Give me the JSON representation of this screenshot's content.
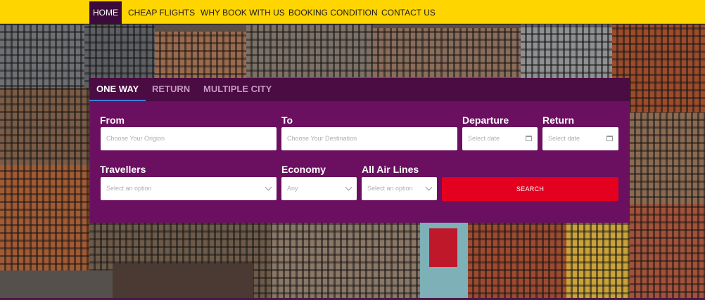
{
  "nav": {
    "items": [
      {
        "label": "HOME",
        "active": true
      },
      {
        "label": "CHEAP FLIGHTS"
      },
      {
        "label": "WHY BOOK WITH US"
      },
      {
        "label": "BOOKING CONDITION"
      },
      {
        "label": "CONTACT US"
      }
    ]
  },
  "colors": {
    "nav_bg": "#ffd500",
    "nav_active_bg": "#3d0b3b",
    "panel_bg": "#6b0f60",
    "tab_bar_bg": "#4b0b43",
    "search_button_bg": "#e4001f"
  },
  "booking": {
    "tabs": [
      {
        "label": "ONE WAY",
        "active": true
      },
      {
        "label": "RETURN"
      },
      {
        "label": "MULTIPLE CITY"
      }
    ],
    "from": {
      "label": "From",
      "placeholder": "Choose Your Origion"
    },
    "to": {
      "label": "To",
      "placeholder": "Choose Your Destination"
    },
    "departure": {
      "label": "Departure",
      "placeholder": "Select date",
      "icon": "calendar-icon"
    },
    "return": {
      "label": "Return",
      "placeholder": "Select date",
      "icon": "calendar-icon"
    },
    "travellers": {
      "label": "Travellers",
      "placeholder": "Select an option",
      "icon": "chevron-down-icon"
    },
    "cabin": {
      "label": "Economy",
      "selected": "Any",
      "icon": "chevron-down-icon"
    },
    "airlines": {
      "label": "All Air Lines",
      "placeholder": "Select an option",
      "icon": "chevron-down-icon"
    },
    "search_label": "SEARCH"
  }
}
